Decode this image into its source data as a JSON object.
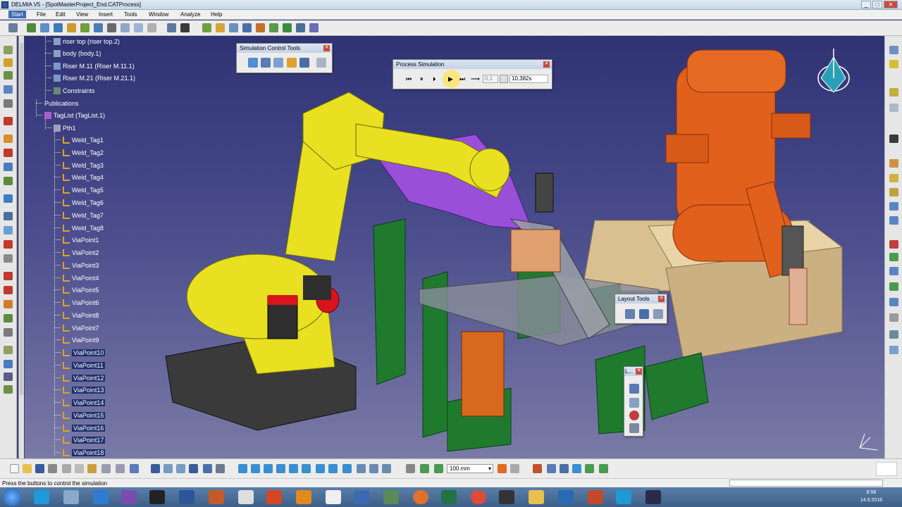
{
  "window": {
    "title": "DELMIA V5 - [SpotMasterProject_End.CATProcess]",
    "min": "_",
    "max": "□",
    "close": "✕"
  },
  "menu": [
    "Start",
    "File",
    "Edit",
    "View",
    "Insert",
    "Tools",
    "Window",
    "Analyze",
    "Help"
  ],
  "tree": [
    {
      "label": "riser top (riser top.2)"
    },
    {
      "label": "body (body.1)"
    },
    {
      "label": "Riser M.11 (Riser M.11.1)"
    },
    {
      "label": "Riser M.21 (Riser M.21.1)"
    },
    {
      "label": "Constraints"
    },
    {
      "label": "Publications"
    },
    {
      "label": "TagList (TagList.1)"
    },
    {
      "label": "Pth1"
    },
    {
      "label": "Weld_Tag1"
    },
    {
      "label": "Weld_Tag2"
    },
    {
      "label": "Weld_Tag3"
    },
    {
      "label": "Weld_Tag4"
    },
    {
      "label": "Weld_Tag5"
    },
    {
      "label": "Weld_Tag6"
    },
    {
      "label": "Weld_Tag7"
    },
    {
      "label": "Weld_Tag8"
    },
    {
      "label": "ViaPoint1"
    },
    {
      "label": "ViaPoint2"
    },
    {
      "label": "ViaPoint3"
    },
    {
      "label": "ViaPoint4"
    },
    {
      "label": "ViaPoint5"
    },
    {
      "label": "ViaPoint6"
    },
    {
      "label": "ViaPoint8"
    },
    {
      "label": "ViaPoint7"
    },
    {
      "label": "ViaPoint9"
    },
    {
      "label": "ViaPoint10"
    },
    {
      "label": "ViaPoint11"
    },
    {
      "label": "ViaPoint12"
    },
    {
      "label": "ViaPoint13"
    },
    {
      "label": "ViaPoint14"
    },
    {
      "label": "ViaPoint15"
    },
    {
      "label": "ViaPoint16"
    },
    {
      "label": "ViaPoint17"
    },
    {
      "label": "ViaPoint18"
    }
  ],
  "panels": {
    "sim_control": {
      "title": "Simulation Control Tools"
    },
    "process_sim": {
      "title": "Process Simulation",
      "step": "0,1",
      "time": "10,382s"
    },
    "layout": {
      "title": "Layout Tools"
    },
    "small": {
      "title": "L..."
    }
  },
  "bottom": {
    "unit": "100 mm"
  },
  "status": {
    "message": "Press the buttons to control the simulation"
  },
  "clock": {
    "time": "8:56",
    "date": "14.9.2016"
  },
  "colors": {
    "robot_yellow": "#e8e020",
    "robot_orange": "#e0601c",
    "fixture_green": "#1f7a2e",
    "part_purple": "#9a4fd8"
  }
}
